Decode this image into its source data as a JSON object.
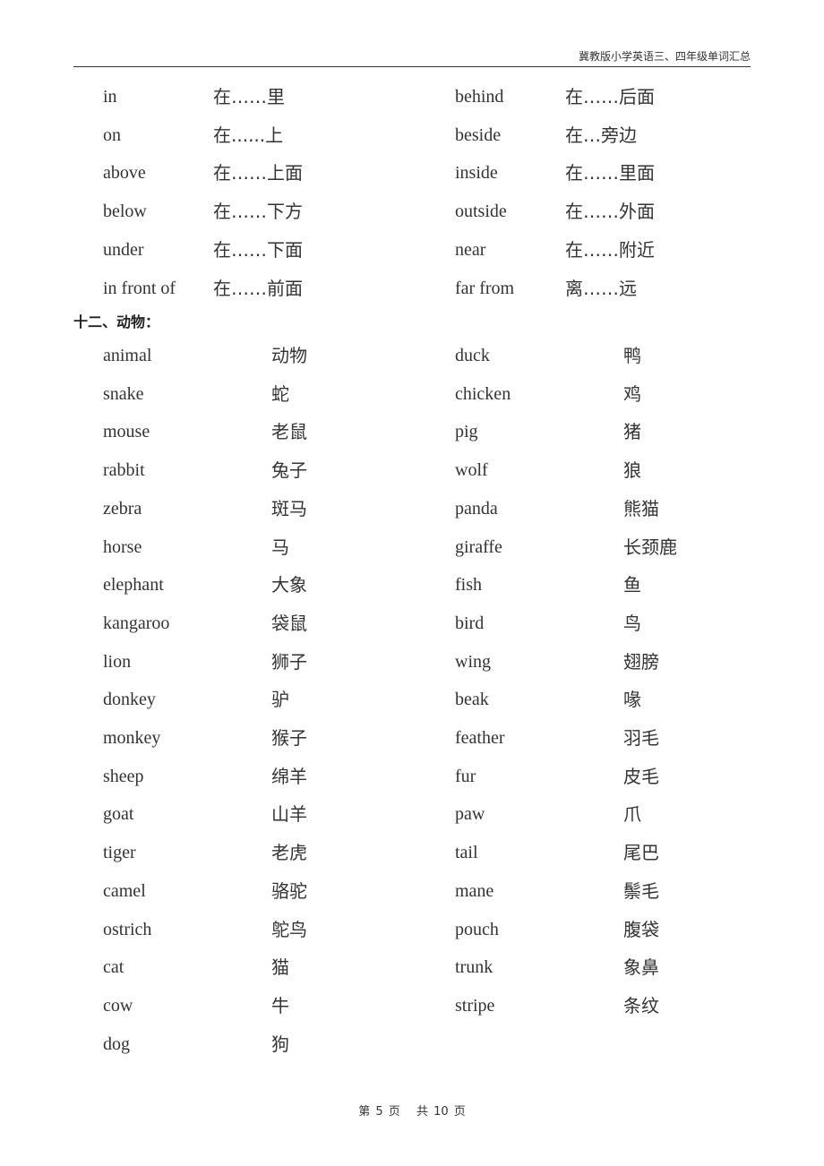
{
  "header": {
    "title": "冀教版小学英语三、四年级单词汇总"
  },
  "prepositions": {
    "left": [
      {
        "en": "in",
        "zh": "在……里"
      },
      {
        "en": "on",
        "zh": "在......上"
      },
      {
        "en": "above",
        "zh": "在……上面"
      },
      {
        "en": "below",
        "zh": "在……下方"
      },
      {
        "en": "under",
        "zh": "在……下面"
      },
      {
        "en": "in front of",
        "zh": "在……前面"
      }
    ],
    "right": [
      {
        "en": "behind",
        "zh": "在……后面"
      },
      {
        "en": "beside",
        "zh": "在…旁边"
      },
      {
        "en": "inside",
        "zh": "在……里面"
      },
      {
        "en": "outside",
        "zh": "在……外面"
      },
      {
        "en": "near",
        "zh": "在……附近"
      },
      {
        "en": "far from",
        "zh": "离……远"
      }
    ]
  },
  "animals": {
    "section_title": "十二、动物：",
    "left": [
      {
        "en": "animal",
        "zh": "动物"
      },
      {
        "en": "snake",
        "zh": "蛇"
      },
      {
        "en": "mouse",
        "zh": "老鼠"
      },
      {
        "en": "rabbit",
        "zh": "兔子"
      },
      {
        "en": "zebra",
        "zh": "斑马"
      },
      {
        "en": "horse",
        "zh": "马"
      },
      {
        "en": "elephant",
        "zh": "大象"
      },
      {
        "en": "kangaroo",
        "zh": "袋鼠"
      },
      {
        "en": "lion",
        "zh": "狮子"
      },
      {
        "en": "donkey",
        "zh": "驴"
      },
      {
        "en": "monkey",
        "zh": "猴子"
      },
      {
        "en": "sheep",
        "zh": "绵羊"
      },
      {
        "en": "goat",
        "zh": "山羊"
      },
      {
        "en": "tiger",
        "zh": "老虎"
      },
      {
        "en": "camel",
        "zh": "骆驼"
      },
      {
        "en": "ostrich",
        "zh": "鸵鸟"
      },
      {
        "en": "cat",
        "zh": "猫"
      },
      {
        "en": "cow",
        "zh": "牛"
      },
      {
        "en": "dog",
        "zh": "狗"
      }
    ],
    "right": [
      {
        "en": "duck",
        "zh": "鸭"
      },
      {
        "en": "chicken",
        "zh": "鸡"
      },
      {
        "en": "pig",
        "zh": "猪"
      },
      {
        "en": "wolf",
        "zh": "狼"
      },
      {
        "en": "panda",
        "zh": "熊猫"
      },
      {
        "en": "giraffe",
        "zh": "长颈鹿"
      },
      {
        "en": "fish",
        "zh": "鱼"
      },
      {
        "en": "bird",
        "zh": "鸟"
      },
      {
        "en": "wing",
        "zh": "翅膀"
      },
      {
        "en": "beak",
        "zh": "喙"
      },
      {
        "en": "feather",
        "zh": "羽毛"
      },
      {
        "en": "fur",
        "zh": "皮毛"
      },
      {
        "en": "paw",
        "zh": "爪"
      },
      {
        "en": "tail",
        "zh": "尾巴"
      },
      {
        "en": "mane",
        "zh": "鬃毛"
      },
      {
        "en": "pouch",
        "zh": "腹袋"
      },
      {
        "en": "trunk",
        "zh": "象鼻"
      },
      {
        "en": "stripe",
        "zh": "条纹"
      }
    ]
  },
  "footer": {
    "current_page_label": "第 5 页",
    "total_pages_label": "共 10 页"
  }
}
